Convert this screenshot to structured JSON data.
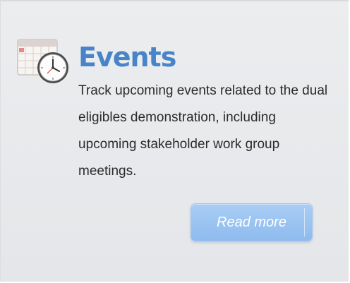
{
  "card": {
    "icon": "calendar-clock-icon",
    "title": "Events",
    "description": "Track upcoming events related to the dual eligibles demonstration, including upcoming stakeholder work group meetings.",
    "read_more_label": "Read more"
  },
  "colors": {
    "background": "#e8e9ec",
    "title": "#4a84c8",
    "text": "#2b2b2b",
    "button": "#9cc4f1",
    "button_text": "#ffffff"
  }
}
